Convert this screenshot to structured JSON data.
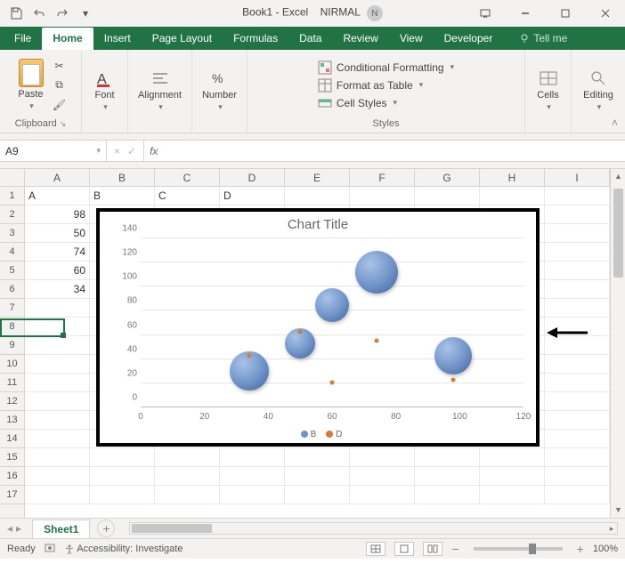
{
  "titlebar": {
    "doc": "Book1 - Excel",
    "user": "NIRMAL",
    "user_initial": "N"
  },
  "tabs": {
    "file": "File",
    "home": "Home",
    "insert": "Insert",
    "pagelayout": "Page Layout",
    "formulas": "Formulas",
    "data": "Data",
    "review": "Review",
    "view": "View",
    "developer": "Developer",
    "tellme": "Tell me"
  },
  "ribbon": {
    "paste": "Paste",
    "clipboard": "Clipboard",
    "font": "Font",
    "alignment": "Alignment",
    "number": "Number",
    "cond": "Conditional Formatting",
    "table": "Format as Table",
    "cellstyles": "Cell Styles",
    "styles": "Styles",
    "cells": "Cells",
    "editing": "Editing"
  },
  "namebox": "A9",
  "columns": [
    "A",
    "B",
    "C",
    "D",
    "E",
    "F",
    "G",
    "H",
    "I"
  ],
  "rows": [
    "1",
    "2",
    "3",
    "4",
    "5",
    "6",
    "7",
    "8",
    "9",
    "10",
    "11",
    "12",
    "13",
    "14",
    "15",
    "16",
    "17"
  ],
  "sheet": {
    "headers": {
      "A": "A",
      "B": "B",
      "C": "C",
      "D": "D"
    },
    "colA": [
      "98",
      "50",
      "74",
      "60",
      "34"
    ]
  },
  "chart_data": {
    "type": "bubble",
    "title": "Chart Title",
    "xlim": [
      0,
      120
    ],
    "ylim": [
      0,
      140
    ],
    "xticks": [
      0,
      20,
      40,
      60,
      80,
      100,
      120
    ],
    "yticks": [
      0,
      20,
      40,
      60,
      80,
      100,
      120,
      140
    ],
    "series": [
      {
        "name": "B",
        "type": "bubble",
        "points": [
          {
            "x": 34,
            "y": 30,
            "size": 44
          },
          {
            "x": 50,
            "y": 53,
            "size": 34
          },
          {
            "x": 60,
            "y": 85,
            "size": 38
          },
          {
            "x": 74,
            "y": 112,
            "size": 48
          },
          {
            "x": 98,
            "y": 43,
            "size": 42
          }
        ]
      },
      {
        "name": "D",
        "type": "scatter",
        "points": [
          {
            "x": 34,
            "y": 43
          },
          {
            "x": 50,
            "y": 63
          },
          {
            "x": 60,
            "y": 21
          },
          {
            "x": 74,
            "y": 55
          },
          {
            "x": 98,
            "y": 23
          }
        ]
      }
    ]
  },
  "sheettab": "Sheet1",
  "status": {
    "ready": "Ready",
    "acc": "Accessibility: Investigate",
    "zoom": "100%"
  }
}
